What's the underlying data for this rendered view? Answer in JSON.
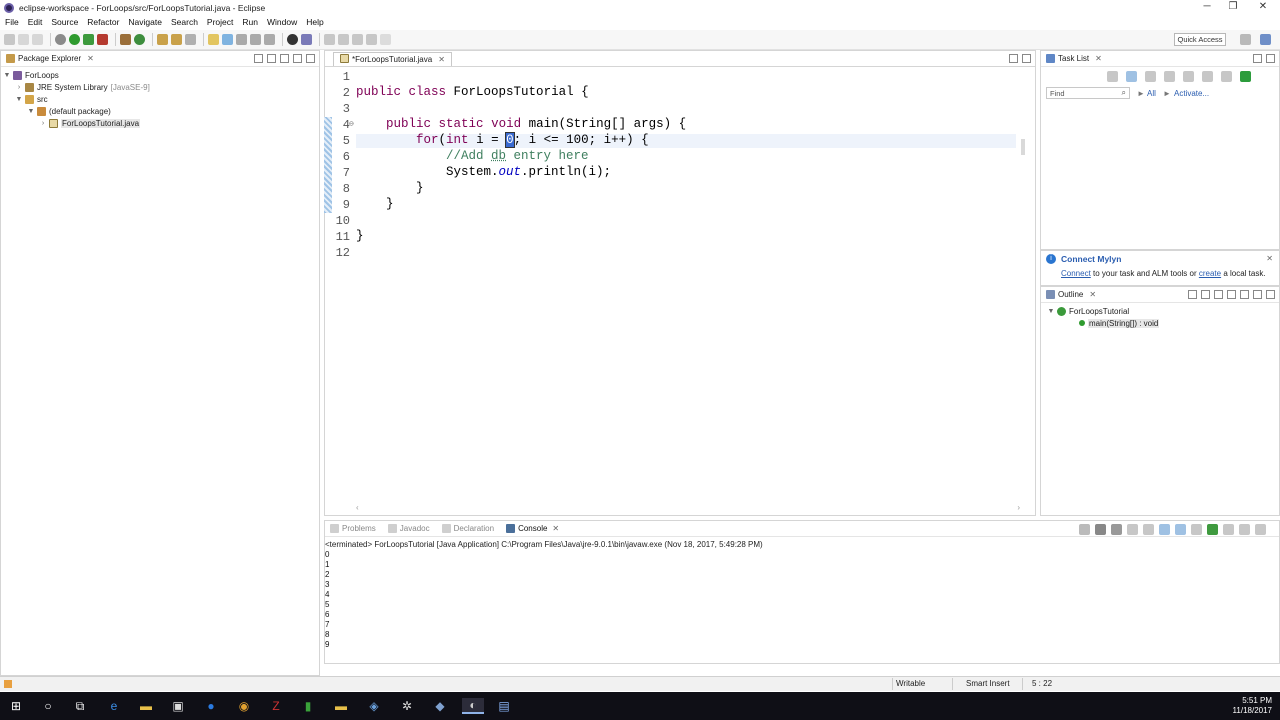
{
  "window": {
    "title": "eclipse-workspace - ForLoops/src/ForLoopsTutorial.java - Eclipse",
    "min": "─",
    "max": "❐",
    "close": "✕"
  },
  "menu": [
    "File",
    "Edit",
    "Source",
    "Refactor",
    "Navigate",
    "Search",
    "Project",
    "Run",
    "Window",
    "Help"
  ],
  "toolbar": {
    "quick_access": "Quick Access"
  },
  "package_explorer": {
    "title": "Package Explorer",
    "tree": [
      {
        "label": "ForLoops",
        "depth": 0,
        "expanded": true,
        "icon": "project-icon"
      },
      {
        "label": "JRE System Library",
        "suffix": "[JavaSE-9]",
        "depth": 1,
        "expanded": false,
        "icon": "library-icon"
      },
      {
        "label": "src",
        "depth": 1,
        "expanded": true,
        "icon": "source-folder-icon"
      },
      {
        "label": "(default package)",
        "depth": 2,
        "expanded": true,
        "icon": "package-icon"
      },
      {
        "label": "ForLoopsTutorial.java",
        "depth": 3,
        "expanded": false,
        "icon": "java-file-icon"
      }
    ]
  },
  "editor": {
    "tab": "*ForLoopsTutorial.java",
    "line_numbers": [
      "1",
      "2",
      "3",
      "4",
      "5",
      "6",
      "7",
      "8",
      "9",
      "10",
      "11",
      "12"
    ],
    "cursor_position": "5 : 22"
  },
  "task_list": {
    "title": "Task List",
    "find_placeholder": "Find",
    "all": "All",
    "activate": "Activate..."
  },
  "mylyn": {
    "title": "Connect Mylyn",
    "connect": "Connect",
    "text1": " to your task and ALM tools or ",
    "create": "create",
    "text2": " a local task."
  },
  "outline": {
    "title": "Outline",
    "class": "ForLoopsTutorial",
    "method": "main(String[]) : void"
  },
  "console": {
    "tabs": [
      "Problems",
      "Javadoc",
      "Declaration",
      "Console"
    ],
    "active_tab": "Console",
    "header": "<terminated> ForLoopsTutorial [Java Application] C:\\Program Files\\Java\\jre-9.0.1\\bin\\javaw.exe (Nov 18, 2017, 5:49:28 PM)",
    "lines": [
      "0",
      "1",
      "2",
      "3",
      "4",
      "5",
      "6",
      "7",
      "8",
      "9"
    ]
  },
  "status": {
    "writable": "Writable",
    "insert": "Smart Insert",
    "position": "5 : 22"
  },
  "taskbar": {
    "time": "5:51 PM",
    "date": "11/18/2017"
  }
}
